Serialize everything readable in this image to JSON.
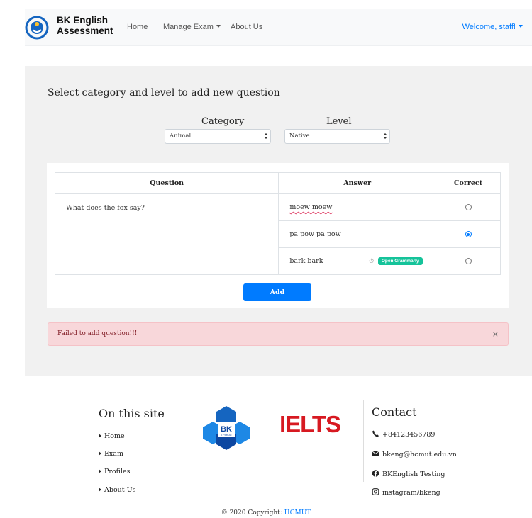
{
  "navbar": {
    "brand_line1": "BK English",
    "brand_line2": "Assessment",
    "links": [
      "Home",
      "Manage Exam",
      "About Us"
    ],
    "welcome": "Welcome, staff!"
  },
  "form": {
    "title": "Select category and level to add new question",
    "category_label": "Category",
    "category_value": "Animal",
    "level_label": "Level",
    "level_value": "Native"
  },
  "table": {
    "headers": [
      "Question",
      "Answer",
      "Correct"
    ],
    "question": "What does the fox say?",
    "answers": [
      {
        "text": "moew moew",
        "correct": false
      },
      {
        "text": "pa pow pa pow",
        "correct": true
      },
      {
        "text": "bark bark",
        "correct": false
      }
    ],
    "grammarly_label": "Open Grammarly"
  },
  "add_button": "Add",
  "alert": {
    "message": "Failed to add question!!!",
    "close": "×"
  },
  "footer": {
    "site_title": "On this site",
    "site_links": [
      "Home",
      "Exam",
      "Profiles",
      "About Us"
    ],
    "logo_bk_line1": "BK",
    "logo_bk_line2": "TP.HCM",
    "logo_ielts": "IELTS",
    "contact_title": "Contact",
    "phone": "+84123456789",
    "email": "bkeng@hcmut.edu.vn",
    "facebook": "BKEnglish Testing",
    "instagram": "instagram/bkeng",
    "copyright_prefix": "© 2020 Copyright:",
    "copyright_link": "HCMUT"
  },
  "colors": {
    "primary": "#007bff",
    "alert_bg": "#f8d7da",
    "grammarly": "#15c39a",
    "bk_blue": "#1565c0"
  }
}
